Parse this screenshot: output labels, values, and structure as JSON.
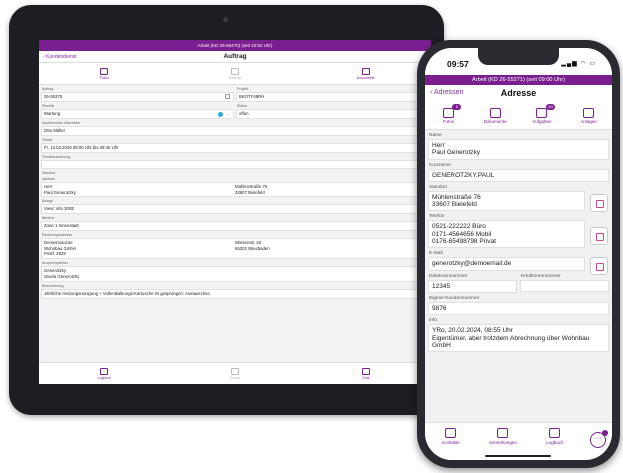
{
  "tablet": {
    "status_bar": "Arbeit (KD 26-55470) (seit 10:52 Uhr)",
    "nav": {
      "back_label": "Kundendienst",
      "title": "Auftrag"
    },
    "tabs": [
      {
        "label": "Fotos",
        "icon": "photo-icon"
      },
      {
        "label": "Material",
        "icon": "material-icon"
      },
      {
        "label": "Dokumente",
        "icon": "document-icon"
      }
    ],
    "fields": {
      "auftrag": {
        "label": "Auftrag",
        "value": "26-55375"
      },
      "projekt": {
        "label": "Projekt",
        "value": "BKOTF48RH"
      },
      "prioritaet": {
        "label": "Priorität",
        "value": "Wartung"
      },
      "status": {
        "label": "Status",
        "value": "offen"
      },
      "mitarbeiter": {
        "label": "Ausführender Mitarbeiter",
        "value": "Otto Müller"
      },
      "termin": {
        "label": "Termin",
        "value": "Fr, 13.02.2026 08:00 Uhr bis 09:30 Uhr"
      },
      "terminanmerkung": {
        "label": "Terminanmerkung",
        "value": ""
      }
    },
    "standort": {
      "section_label": "Standort",
      "adresse_label": "Adresse",
      "adresse_name": "Herr\nPaul Generotzky",
      "adresse_street": "Mühlenstraße 76\n33607 Bielefeld",
      "anlage_label": "Anlage",
      "anlage_value": "Viesc Vito 300E",
      "bereich_label": "Bereich",
      "bereich_value": "Zone 1 Innenstadt"
    },
    "rechnung": {
      "label": "Rechnungsadresse",
      "name": "Demeimolozue\nWohnbau GmbH\nPostf. 2829",
      "street": "Wiesenstr. 33\n65203 Wiesbaden"
    },
    "ansprechpartner": {
      "label": "Ansprechpartner",
      "value": "Generotzky\nGisela Generotzky"
    },
    "beschreibung": {
      "label": "Beschreibung",
      "value": "Jährliche Heizungsreinigung + Vollentkalkungs-Kartusche ist gesprungen: Austauschen"
    },
    "bottom": [
      {
        "label": "Logbuch",
        "icon": "logbook-icon"
      },
      {
        "label": "Scripte",
        "icon": "script-icon"
      },
      {
        "label": "Chat",
        "icon": "chat-icon"
      }
    ]
  },
  "phone": {
    "time": "09:57",
    "status_bar": "Arbeit (KD 26-55271) (seit 09:00 Uhr)",
    "nav": {
      "back_label": "Adressen",
      "title": "Adresse"
    },
    "tabs": [
      {
        "label": "Fotos",
        "icon": "photo-icon",
        "badge": "5"
      },
      {
        "label": "Dokumente",
        "icon": "document-icon",
        "badge": ""
      },
      {
        "label": "Aufgaben",
        "icon": "task-icon",
        "badge": "3/3"
      },
      {
        "label": "Anlagen",
        "icon": "device-icon",
        "badge": ""
      }
    ],
    "fields": {
      "name": {
        "label": "Name",
        "value": "Herr\nPaul Generotzky"
      },
      "kurzname": {
        "label": "Kurzname",
        "value": "GENEROTZKY,PAUL"
      },
      "standort": {
        "label": "Standort",
        "value": "Mühlenstraße 76\n33607 Bielefeld"
      },
      "telefon": {
        "label": "Telefon",
        "value": "0521-222222 Büro\n0171-4564656 Mobil\n0176-65498798 Privat"
      },
      "email": {
        "label": "E-Mail",
        "value": "generotzky@demoemail.de"
      },
      "debitor": {
        "label": "Debitorennummer",
        "value": "12345"
      },
      "kreditor": {
        "label": "Kreditorennummer",
        "value": ""
      },
      "eigene": {
        "label": "Eigene Kundennummer",
        "value": "9876"
      },
      "info": {
        "label": "Info",
        "value": "YRo, 20.02.2024, 08:55 Uhr\nEigentümer, aber trotzdem Abrechnung über Wohnbau GmbH"
      }
    },
    "bottom": [
      {
        "label": "Kontakte",
        "icon": "contacts-icon"
      },
      {
        "label": "Anmerkungen",
        "icon": "notes-icon"
      },
      {
        "label": "Logbuch",
        "icon": "logbook-icon"
      }
    ],
    "more_label": "···"
  },
  "colors": {
    "accent": "#7a1f8f",
    "status_dot": "#2fa8e0"
  }
}
